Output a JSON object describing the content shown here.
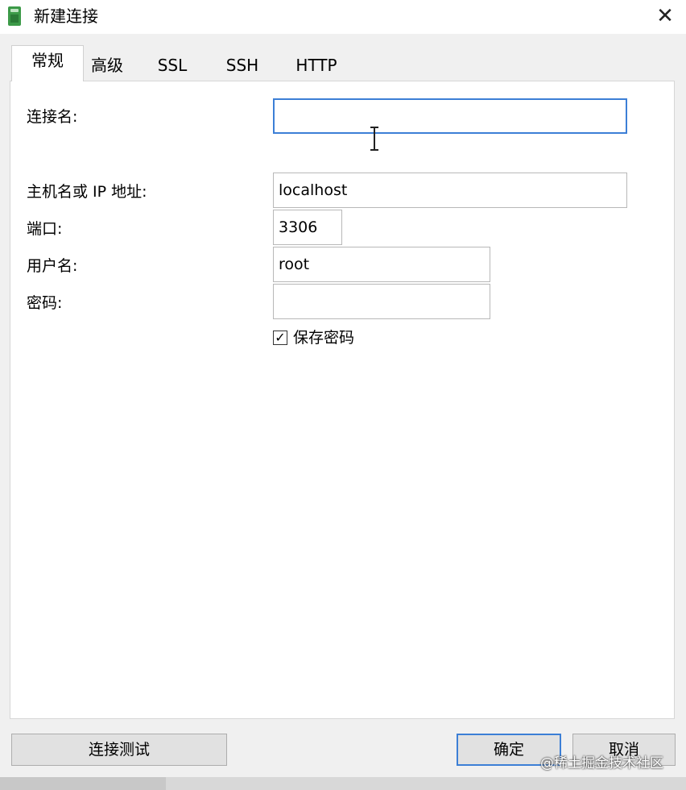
{
  "window": {
    "title": "新建连接",
    "close_glyph": "✕",
    "icon": "database-icon"
  },
  "tabs": [
    {
      "label": "常规",
      "active": true
    },
    {
      "label": "高级",
      "active": false
    },
    {
      "label": "SSL",
      "active": false
    },
    {
      "label": "SSH",
      "active": false
    },
    {
      "label": "HTTP",
      "active": false
    }
  ],
  "form": {
    "connection_name": {
      "label": "连接名:",
      "value": ""
    },
    "host": {
      "label": "主机名或 IP 地址:",
      "value": "localhost"
    },
    "port": {
      "label": "端口:",
      "value": "3306"
    },
    "username": {
      "label": "用户名:",
      "value": "root"
    },
    "password": {
      "label": "密码:",
      "value": ""
    },
    "save_password": {
      "label": "保存密码",
      "checked": true,
      "check_glyph": "✓"
    }
  },
  "buttons": {
    "test_connection": "连接测试",
    "ok": "确定",
    "cancel": "取消"
  },
  "watermark": "@稀土掘金技术社区",
  "colors": {
    "focus_accent": "#3c7fd6",
    "app_icon": "#3c9a48"
  }
}
